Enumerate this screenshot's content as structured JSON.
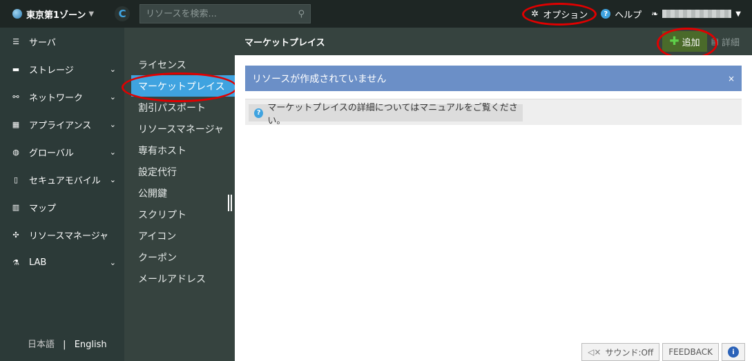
{
  "topbar": {
    "zone_label": "東京第1ゾーン",
    "search_placeholder": "リソースを検索...",
    "options_label": "オプション",
    "help_label": "ヘルプ"
  },
  "sidebar": {
    "items": [
      {
        "label": "サーバ",
        "icon": "server-icon",
        "expandable": false
      },
      {
        "label": "ストレージ",
        "icon": "storage-icon",
        "expandable": true
      },
      {
        "label": "ネットワーク",
        "icon": "network-icon",
        "expandable": true
      },
      {
        "label": "アプライアンス",
        "icon": "appliance-icon",
        "expandable": true
      },
      {
        "label": "グローバル",
        "icon": "globe-icon",
        "expandable": true
      },
      {
        "label": "セキュアモバイル",
        "icon": "mobile-icon",
        "expandable": true
      },
      {
        "label": "マップ",
        "icon": "map-icon",
        "expandable": false
      },
      {
        "label": "リソースマネージャ",
        "icon": "puzzle-icon",
        "expandable": false
      },
      {
        "label": "LAB",
        "icon": "flask-icon",
        "expandable": true
      }
    ],
    "lang_ja": "日本語",
    "lang_sep": "|",
    "lang_en": "English"
  },
  "subnav": {
    "items": [
      {
        "label": "ライセンス",
        "active": false
      },
      {
        "label": "マーケットプレイス",
        "active": true
      },
      {
        "label": "割引パスポート",
        "active": false
      },
      {
        "label": "リソースマネージャ",
        "active": false
      },
      {
        "label": "専有ホスト",
        "active": false
      },
      {
        "label": "設定代行",
        "active": false
      },
      {
        "label": "公開鍵",
        "active": false
      },
      {
        "label": "スクリプト",
        "active": false
      },
      {
        "label": "アイコン",
        "active": false
      },
      {
        "label": "クーポン",
        "active": false
      },
      {
        "label": "メールアドレス",
        "active": false
      }
    ]
  },
  "main": {
    "title": "マーケットプレイス",
    "add_label": "追加",
    "detail_label": "詳細",
    "alert_text": "リソースが作成されていません",
    "alert_close": "×",
    "info_text": "マーケットプレイスの詳細についてはマニュアルをご覧ください。"
  },
  "bottom": {
    "sound_label": "サウンド:Off",
    "feedback_label": "FEEDBACK"
  }
}
